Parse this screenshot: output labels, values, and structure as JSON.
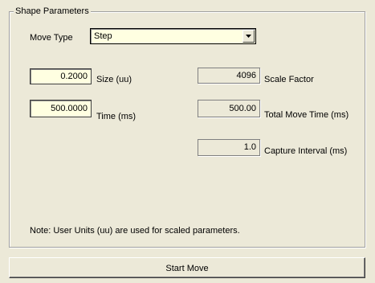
{
  "group": {
    "title": "Shape Parameters"
  },
  "move_type": {
    "label": "Move Type",
    "selected": "Step"
  },
  "size": {
    "value": "0.2000",
    "label": "Size (uu)"
  },
  "time": {
    "value": "500.0000",
    "label": "Time (ms)"
  },
  "scale_factor": {
    "value": "4096",
    "label": "Scale Factor"
  },
  "total_move_time": {
    "value": "500.00",
    "label": "Total Move Time (ms)"
  },
  "capture_interval": {
    "value": "1.0",
    "label": "Capture Interval (ms)"
  },
  "note": "Note: User Units (uu) are used for scaled parameters.",
  "start_button": {
    "label": "Start Move"
  },
  "icons": {
    "combo_arrow": "chevron-down-icon"
  }
}
